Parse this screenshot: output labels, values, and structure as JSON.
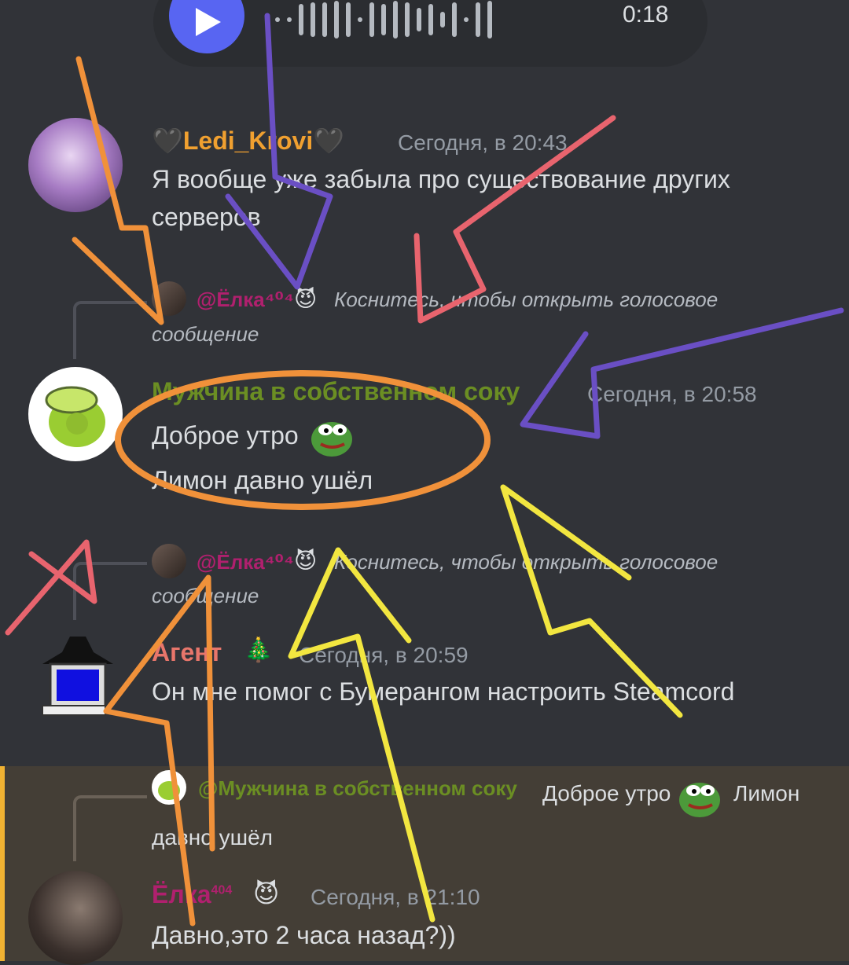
{
  "voice": {
    "duration": "0:18"
  },
  "messages": [
    {
      "author": "🖤Ledi_Krovi🖤",
      "time": "Сегодня, в 20:43",
      "lines": [
        "Я вообще уже забыла про существование других",
        "серверов"
      ]
    },
    {
      "reply": {
        "author": "@Ёлка⁴⁰⁴",
        "emoji": "😈",
        "text": "Коснитесь, чтобы открыть голосовое",
        "text2": "сообщение"
      },
      "author": "Мужчина в собственном соку",
      "time": "Сегодня, в 20:58",
      "lines": [
        "Доброе утро",
        "Лимон давно ушёл"
      ]
    },
    {
      "reply": {
        "author": "@Ёлка⁴⁰⁴",
        "emoji": "😈",
        "text": "Коснитесь, чтобы открыть голосовое",
        "text2": "сообщение"
      },
      "author": "Агент",
      "emoji": "🎄",
      "time": "Сегодня, в 20:59",
      "lines": [
        "Он мне помог с Бумерангом настроить Steamcord"
      ]
    },
    {
      "reply": {
        "author": "@Мужчина в собственном соку",
        "text": "Доброе утро",
        "text_after": "Лимон",
        "text2": "давно ушёл"
      },
      "author": "Ёлка",
      "author_sup": "404",
      "emoji": "😈",
      "time": "Сегодня, в 21:10",
      "lines": [
        "Давно,это 2 часа назад?))"
      ]
    }
  ],
  "colors": {
    "background": "#313338",
    "name_ledi": "#f0a030",
    "name_muzh": "#6b8e23",
    "name_agent": "#e8766b",
    "name_elka": "#b0206e",
    "highlight": "#443e36",
    "accent": "#5865f2"
  }
}
